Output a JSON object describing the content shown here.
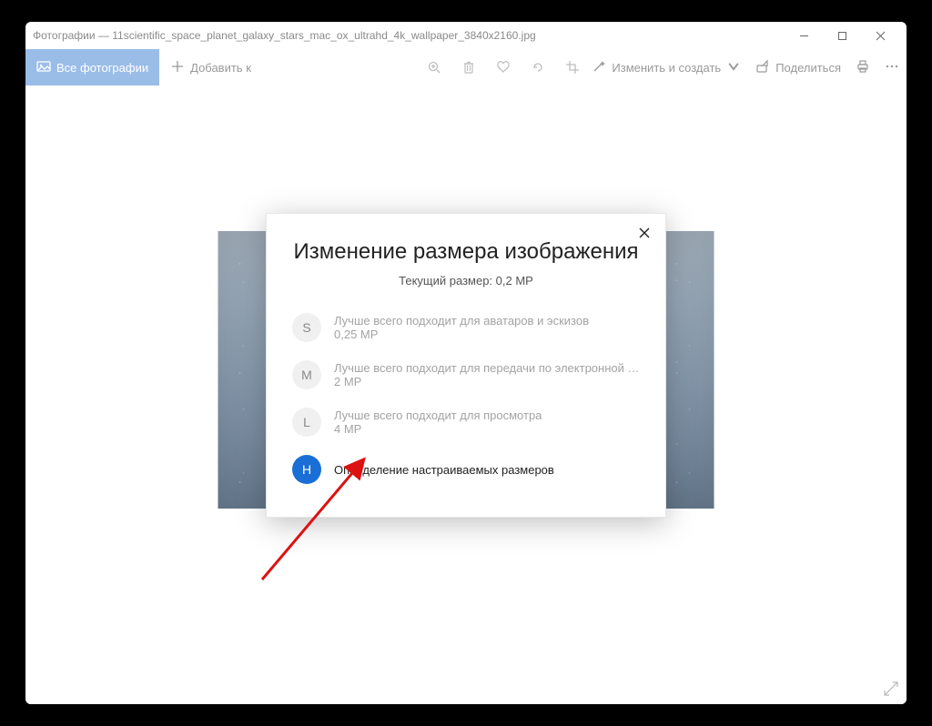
{
  "titlebar": {
    "title": "Фотографии — 11scientific_space_planet_galaxy_stars_mac_ox_ultrahd_4k_wallpaper_3840x2160.jpg"
  },
  "toolbar": {
    "all_photos": "Все фотографии",
    "add_to": "Добавить к",
    "edit_create": "Изменить и создать",
    "share": "Поделиться"
  },
  "dialog": {
    "title": "Изменение размера изображения",
    "current_size": "Текущий размер: 0,2 MP",
    "options": [
      {
        "key": "S",
        "line1": "Лучше всего подходит для аватаров и эскизов",
        "line2": "0,25 MP",
        "selected": false
      },
      {
        "key": "M",
        "line1": "Лучше всего подходит для передачи по электронной почте и",
        "line2": "2 MP",
        "selected": false
      },
      {
        "key": "L",
        "line1": "Лучше всего подходит для просмотра",
        "line2": "4 MP",
        "selected": false
      },
      {
        "key": "H",
        "line1": "Определение настраиваемых размеров",
        "line2": "",
        "selected": true
      }
    ]
  }
}
